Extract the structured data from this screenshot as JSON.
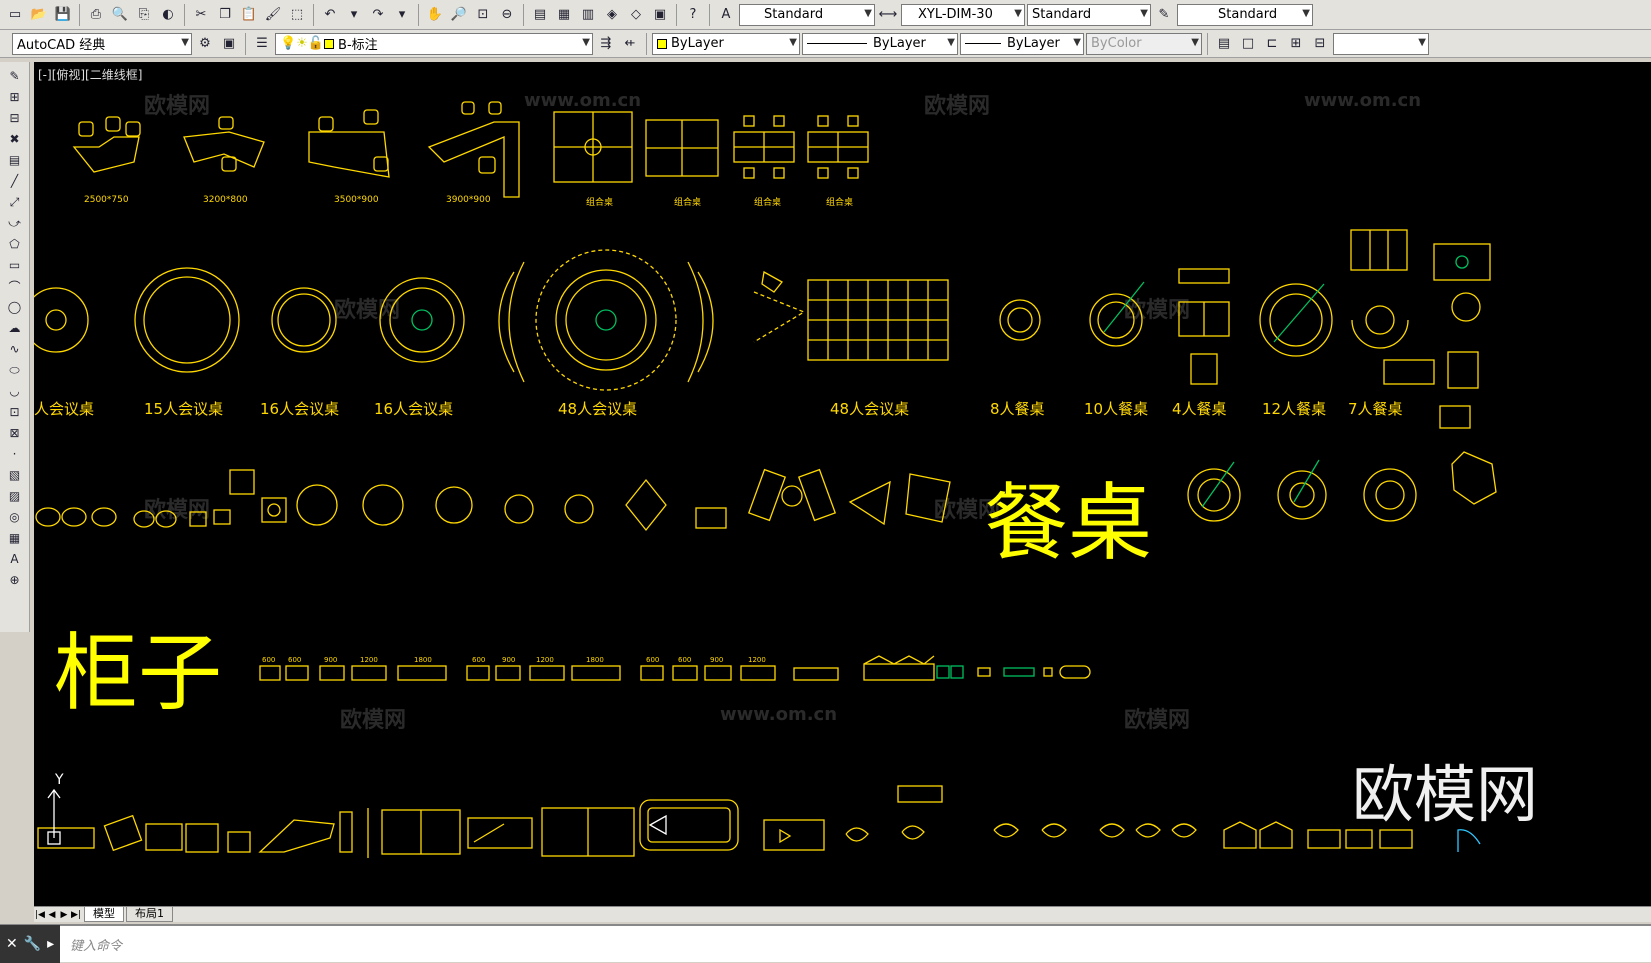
{
  "toolbar1": {
    "text_style": "Standard",
    "dim_style": "XYL-DIM-30",
    "table_style": "Standard",
    "mleader_style": "Standard"
  },
  "toolbar2": {
    "workspace": "AutoCAD 经典",
    "layer": "B-标注",
    "color": "ByLayer",
    "linetype": "ByLayer",
    "lineweight": "ByLayer",
    "plotstyle": "ByColor"
  },
  "viewport_label": "[-][俯视][二维线框]",
  "watermarks": [
    "欧模网",
    "www.om.cn"
  ],
  "row1_labels": [
    "2500*750",
    "3200*800",
    "3500*900",
    "3900*900",
    "组合桌",
    "组合桌",
    "组合桌",
    "组合桌"
  ],
  "row2_labels": [
    "人会议桌",
    "15人会议桌",
    "16人会议桌",
    "16人会议桌",
    "48人会议桌",
    "48人会议桌",
    "8人餐桌",
    "10人餐桌",
    "4人餐桌",
    "12人餐桌",
    "7人餐桌"
  ],
  "cabinet_sizes": [
    "600",
    "600",
    "900",
    "1200",
    "1800",
    "600",
    "900",
    "1200",
    "1800",
    "600",
    "600",
    "900",
    "1200"
  ],
  "big_labels": {
    "dining": "餐桌",
    "cabinet": "柜子",
    "brand": "欧模网"
  },
  "ucs": {
    "y": "Y"
  },
  "tabs": [
    "模型",
    "布局1"
  ],
  "command_prompt": "键入命令",
  "colors": {
    "cad_yellow": "#ffd800",
    "canvas_bg": "#000000",
    "accent_green": "#00c060"
  }
}
